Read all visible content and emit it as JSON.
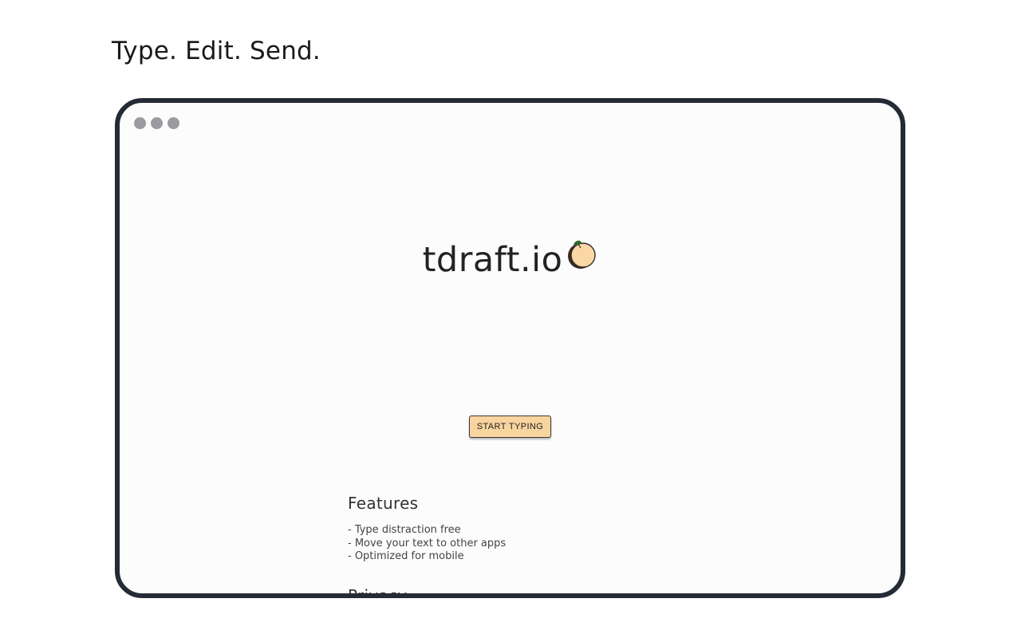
{
  "tagline": "Type. Edit. Send.",
  "window": {
    "dots": [
      "window-dot",
      "window-dot",
      "window-dot"
    ],
    "dot_color": "#9a9ba0",
    "frame_color": "#252b36"
  },
  "brand": {
    "name": "tdraft.io",
    "icon": "peach-icon",
    "icon_color": "#fbd8a3"
  },
  "cta": {
    "label": "START TYPING",
    "color": "#f8d49e"
  },
  "features": {
    "heading": "Features",
    "items": [
      "- Type distraction free",
      "- Move your text to other apps",
      "- Optimized for mobile"
    ]
  },
  "privacy": {
    "heading": "Privacy"
  }
}
